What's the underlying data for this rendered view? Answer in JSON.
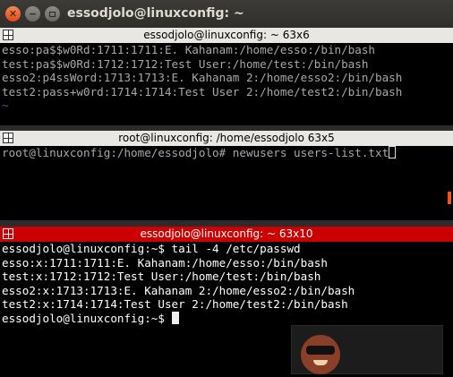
{
  "window": {
    "title": "essodjolo@linuxconfig: ~"
  },
  "panes": [
    {
      "title": "essodjolo@linuxconfig: ~ 63x6",
      "lines": [
        "esso:pa$$w0Rd:1711:1711:E. Kahanam:/home/esso:/bin/bash",
        "test:pa$$w0Rd:1712:1712:Test User:/home/test:/bin/bash",
        "esso2:p4ssWord:1713:1713:E. Kahanam 2:/home/esso2:/bin/bash",
        "test2:pass+w0rd:1714:1714:Test User 2:/home/test2:/bin/bash"
      ],
      "tilde": "~"
    },
    {
      "title": "root@linuxconfig: /home/essodjolo 63x5",
      "prompt_line": "root@linuxconfig:/home/essodjolo# newusers users-list.txt"
    },
    {
      "title": "essodjolo@linuxconfig: ~ 63x10",
      "lines": [
        "essodjolo@linuxconfig:~$ tail -4 /etc/passwd",
        "esso:x:1711:1711:E. Kahanam:/home/esso:/bin/bash",
        "test:x:1712:1712:Test User:/home/test:/bin/bash",
        "esso2:x:1713:1713:E. Kahanam 2:/home/esso2:/bin/bash",
        "test2:x:1714:1714:Test User 2:/home/test2:/bin/bash"
      ],
      "prompt": "essodjolo@linuxconfig:~$ "
    }
  ],
  "colors": {
    "active_bar": "#cc0000",
    "inactive_bar": "#e8e7e3",
    "background": "#000000"
  }
}
